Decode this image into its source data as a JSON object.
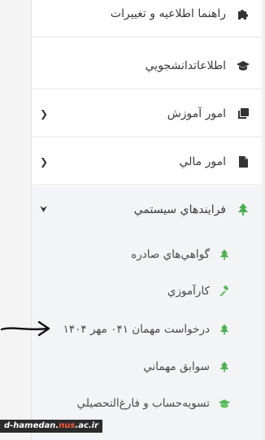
{
  "menu": {
    "items": [
      {
        "label": "راهنما اطلاعيه و تغييرات",
        "icon": "puzzle-icon"
      },
      {
        "label": "اطلاعاتدانشجويي",
        "icon": "graduation-cap-icon"
      },
      {
        "label": "امور آموزش",
        "icon": "copy-icon"
      },
      {
        "label": "امور مالي",
        "icon": "file-icon"
      },
      {
        "label": "فرايندهاي سيستمي",
        "icon": "tree-icon"
      }
    ],
    "subitems": [
      {
        "label": "گواهي‌هاي صادره",
        "icon": "tree-icon"
      },
      {
        "label": "کارآموزي",
        "icon": "gavel-icon"
      },
      {
        "label": "درخواست مهمان ۰۴۱ مهر ۱۴۰۴",
        "icon": "tree-icon"
      },
      {
        "label": "سوابق مهماني",
        "icon": "tree-icon"
      },
      {
        "label": "تسويه‌حساب و فارغ‌التحصيلي",
        "icon": "graduation-cap-icon"
      }
    ]
  },
  "watermark": {
    "prefix": "d-hamedan.",
    "highlight": "nus",
    "suffix": ".ac.ir"
  },
  "colors": {
    "tree": "#4caf50",
    "gavel": "#5cb85c",
    "grad_green": "#5cb85c",
    "dark_icon": "#333333"
  }
}
